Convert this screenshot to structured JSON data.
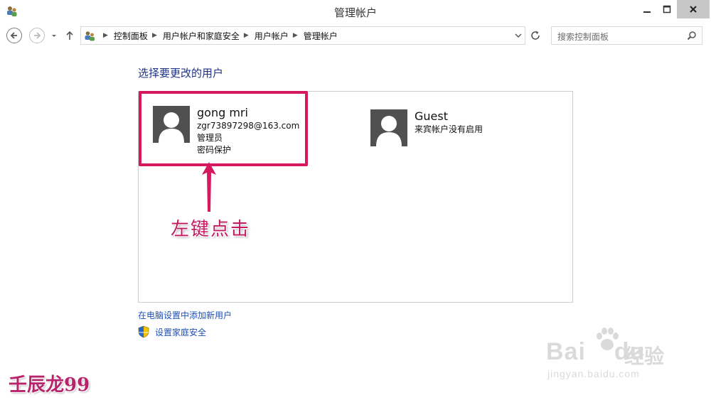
{
  "window": {
    "title": "管理帐户"
  },
  "breadcrumb": {
    "items": [
      "控制面板",
      "用户帐户和家庭安全",
      "用户帐户",
      "管理帐户"
    ]
  },
  "search": {
    "placeholder": "搜索控制面板"
  },
  "content": {
    "heading": "选择要更改的用户",
    "users": [
      {
        "name": "gong mri",
        "lines": [
          "zgr73897298@163.com",
          "管理员",
          "密码保护"
        ]
      },
      {
        "name": "Guest",
        "lines": [
          "来宾帐户没有启用"
        ]
      }
    ],
    "link_add_user": "在电脑设置中添加新用户",
    "link_family_safety": "设置家庭安全"
  },
  "annotation": {
    "text": "左键点击",
    "color": "#d4195f"
  },
  "author": {
    "text": "壬辰龙99"
  },
  "watermark": {
    "brand": "Bai",
    "brand2": "du",
    "cn": "经验",
    "url": "jingyan.baidu.com"
  },
  "icons": {
    "app": "users-control-panel-icon",
    "back": "back-arrow-icon",
    "forward": "forward-arrow-icon",
    "up": "up-arrow-icon",
    "refresh": "refresh-icon",
    "search": "search-icon",
    "shield": "shield-icon"
  }
}
